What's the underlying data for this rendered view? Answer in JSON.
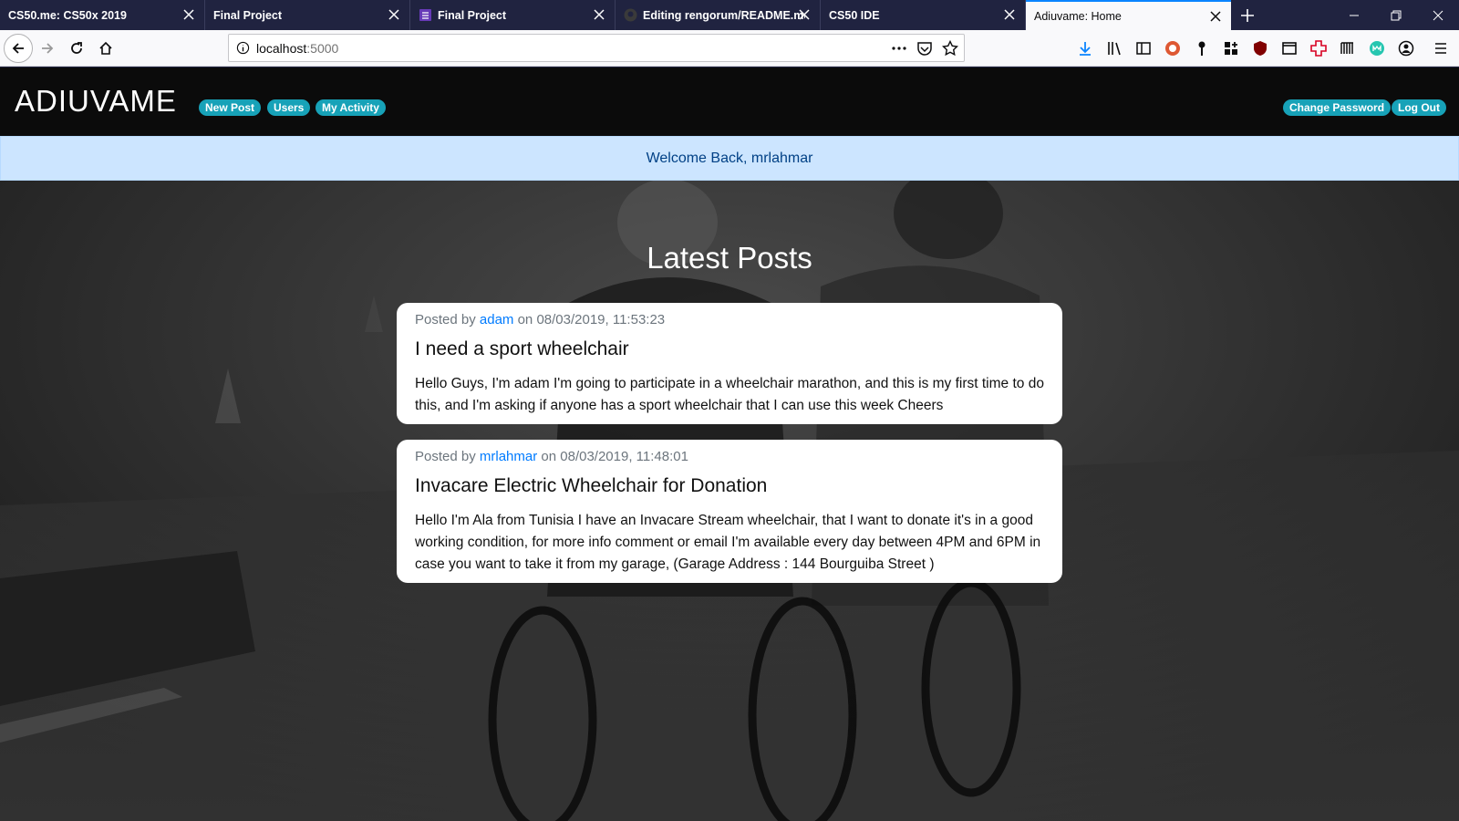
{
  "browser": {
    "tabs": [
      {
        "title": "CS50.me: CS50x 2019",
        "icon": "none"
      },
      {
        "title": "Final Project",
        "icon": "none"
      },
      {
        "title": "Final Project",
        "icon": "form-icon"
      },
      {
        "title": "Editing rengorum/README.md",
        "icon": "github-icon"
      },
      {
        "title": "CS50 IDE",
        "icon": "none"
      },
      {
        "title": "Adiuvame: Home",
        "icon": "none",
        "active": true
      }
    ],
    "url_host": "localhost",
    "url_port": ":5000"
  },
  "site": {
    "brand": "ADIUVAME",
    "nav_left": [
      "New Post",
      "Users",
      "My Activity"
    ],
    "nav_right": [
      "Change Password",
      "Log Out"
    ],
    "alert": "Welcome Back, mrlahmar",
    "heading": "Latest Posts",
    "posts": [
      {
        "prefix": "Posted by ",
        "author": "adam",
        "on": " on ",
        "date": "08/03/2019, 11:53:23",
        "title": "I need a sport wheelchair",
        "body": "Hello Guys, I'm adam I'm going to participate in a wheelchair marathon, and this is my first time to do this, and I'm asking if anyone has a sport wheelchair that I can use this week Cheers"
      },
      {
        "prefix": "Posted by ",
        "author": "mrlahmar",
        "on": " on ",
        "date": "08/03/2019, 11:48:01",
        "title": "Invacare Electric Wheelchair for Donation",
        "body": "Hello I'm Ala from Tunisia I have an Invacare Stream wheelchair, that I want to donate it's in a good working condition, for more info comment or email I'm available every day between 4PM and 6PM in case you want to take it from my garage, (Garage Address : 144 Bourguiba Street )"
      }
    ]
  },
  "colors": {
    "tabstrip": "#202340",
    "pill": "#17a2b8",
    "alert_bg": "#cce5ff",
    "alert_text": "#004085",
    "link": "#007bff"
  }
}
